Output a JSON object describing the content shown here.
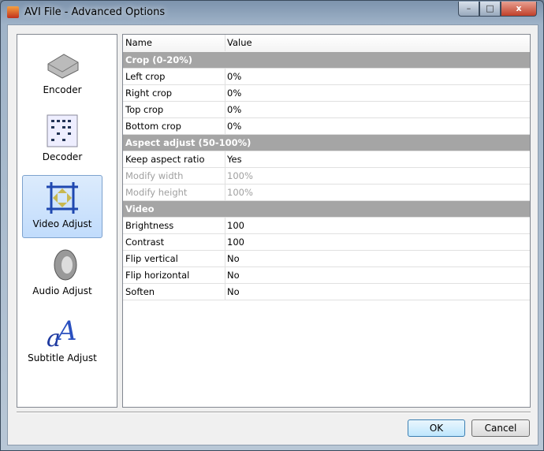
{
  "window": {
    "title": "AVI File - Advanced Options",
    "min": "–",
    "max": "□",
    "close": "x"
  },
  "nav": [
    {
      "label": "Encoder",
      "icon": "drive-icon"
    },
    {
      "label": "Decoder",
      "icon": "grid-icon"
    },
    {
      "label": "Video Adjust",
      "icon": "resize-icon",
      "selected": true
    },
    {
      "label": "Audio Adjust",
      "icon": "speaker-icon"
    },
    {
      "label": "Subtitle Adjust",
      "icon": "font-icon"
    }
  ],
  "grid": {
    "headers": {
      "name": "Name",
      "value": "Value"
    },
    "rows": [
      {
        "type": "cat",
        "name": "Crop (0-20%)"
      },
      {
        "name": "Left crop",
        "value": "0%"
      },
      {
        "name": "Right crop",
        "value": "0%"
      },
      {
        "name": "Top crop",
        "value": "0%"
      },
      {
        "name": "Bottom crop",
        "value": "0%"
      },
      {
        "type": "cat",
        "name": "Aspect adjust (50-100%)"
      },
      {
        "name": "Keep aspect ratio",
        "value": "Yes"
      },
      {
        "name": "Modify width",
        "value": "100%",
        "disabled": true
      },
      {
        "name": "Modify height",
        "value": "100%",
        "disabled": true
      },
      {
        "type": "cat",
        "name": "Video"
      },
      {
        "name": "Brightness",
        "value": "100"
      },
      {
        "name": "Contrast",
        "value": "100"
      },
      {
        "name": "Flip vertical",
        "value": "No"
      },
      {
        "name": "Flip horizontal",
        "value": "No"
      },
      {
        "name": "Soften",
        "value": "No"
      }
    ]
  },
  "buttons": {
    "ok": "OK",
    "cancel": "Cancel"
  }
}
